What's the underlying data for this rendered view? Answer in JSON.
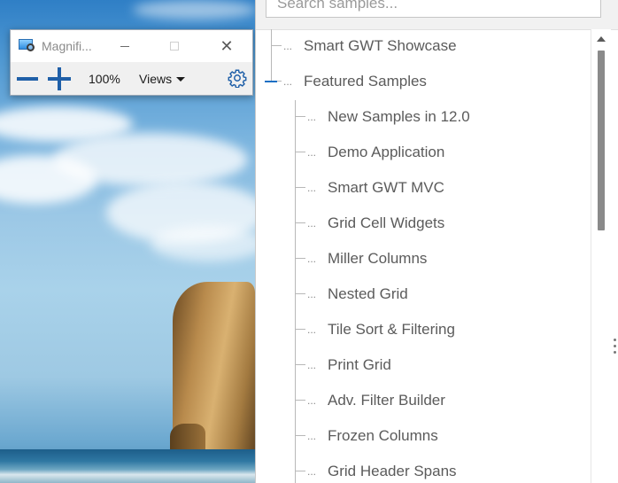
{
  "magnifier": {
    "title": "Magnifi...",
    "zoom_level": "100%",
    "views_label": "Views",
    "icons": {
      "app": "magnifier-app-icon",
      "minimize": "minimize-icon",
      "maximize": "maximize-icon",
      "close": "close-icon",
      "zoom_out": "minus-icon",
      "zoom_in": "plus-icon",
      "settings": "gear-icon",
      "views_dropdown": "caret-down-icon"
    },
    "accent_color": "#1f5fa8"
  },
  "panel": {
    "search": {
      "placeholder": "Search samples..."
    },
    "tree": {
      "top_items": [
        {
          "label": "Smart GWT Showcase"
        },
        {
          "label": "Featured Samples",
          "open": true
        }
      ],
      "children": [
        {
          "label": "New Samples in 12.0"
        },
        {
          "label": "Demo Application"
        },
        {
          "label": "Smart GWT MVC"
        },
        {
          "label": "Grid Cell Widgets"
        },
        {
          "label": "Miller Columns"
        },
        {
          "label": "Nested Grid"
        },
        {
          "label": "Tile Sort & Filtering"
        },
        {
          "label": "Print Grid"
        },
        {
          "label": "Adv. Filter Builder"
        },
        {
          "label": "Frozen Columns"
        },
        {
          "label": "Grid Header Spans"
        }
      ],
      "connector": "..."
    },
    "open_marker_color": "#1c6fc4"
  }
}
